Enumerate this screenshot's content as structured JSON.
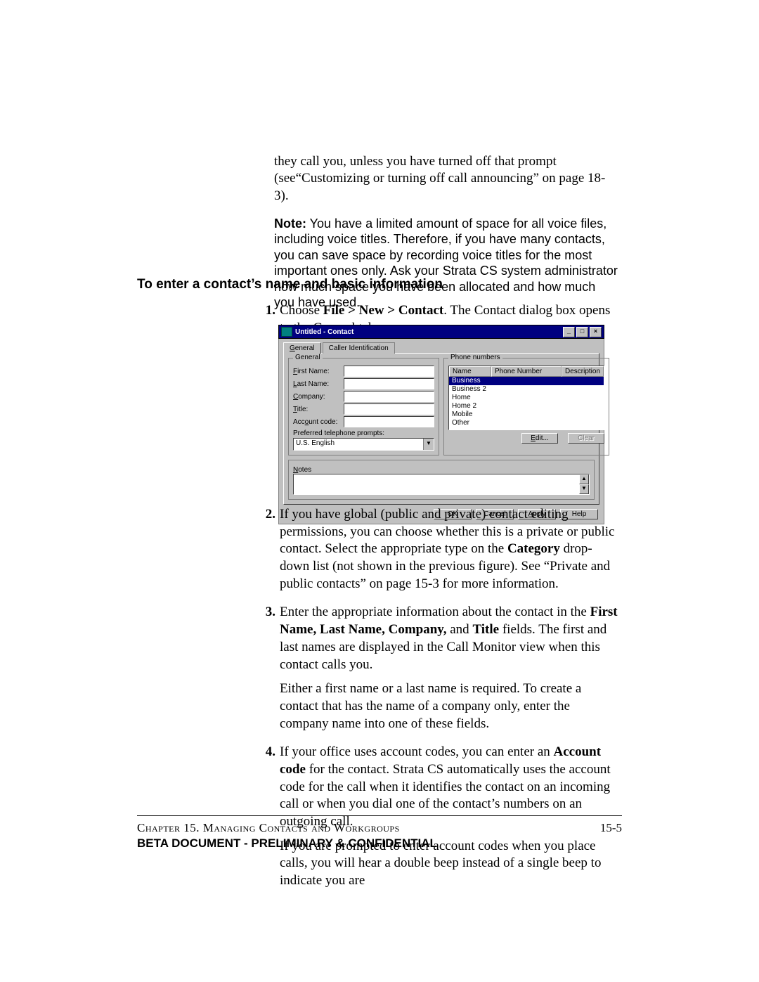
{
  "intro": {
    "p1": "they call you, unless you have turned off that prompt (see“Customizing or turning off call announcing” on page 18-3).",
    "note_label": "Note:",
    "note_body": "  You have a limited amount of space for all voice files, including voice titles. Therefore, if you have many contacts, you can save space by recording voice titles for the most important ones only. Ask your Strata CS system administrator how much space you have been allocated and how much you have used."
  },
  "subhead": "To enter a contact’s name and basic information",
  "steps": {
    "s1": {
      "num": "1.",
      "pre": "Choose ",
      "bold": "File > New > Contact",
      "post": ". The Contact dialog box opens to the General tab."
    },
    "s2": {
      "num": "2.",
      "pre": "If you have global (public and private) contact editing permissions, you can choose whether this is a private or public contact. Select the appropriate type on the ",
      "bold": "Category",
      "post": " drop-down list (not shown in the previous figure). See “Private and public contacts” on page 15-3 for more information."
    },
    "s3": {
      "num": "3.",
      "pre": "Enter the appropriate information about the contact in the ",
      "bold": "First Name, Last Name, Company,",
      "post_mid": " and ",
      "bold2": "Title",
      "post": " fields. The first and last names are displayed in the Call Monitor view when this contact calls you.",
      "p2": "Either a first name or a last name is required. To create a contact that has the name of a company only, enter the company name into one of these fields."
    },
    "s4": {
      "num": "4.",
      "pre": "If your office uses account codes, you can enter an ",
      "bold": "Account code",
      "post": " for the contact. Strata CS automatically uses the account code for the call when it identifies the contact on an incoming call or when you dial one of the contact’s numbers on an outgoing call.",
      "p2": "If you are prompted to enter account codes when you place calls, you will hear a double beep instead of a single beep to indicate you are"
    }
  },
  "dialog": {
    "title": "Untitled - Contact",
    "tabs": {
      "general": "General",
      "caller": "Caller Identification"
    },
    "group_general": "General",
    "labels": {
      "first": "First Name:",
      "last": "Last Name:",
      "company": "Company:",
      "title": "Title:",
      "account": "Account code:",
      "prompt": "Preferred telephone prompts:"
    },
    "combo_value": "U.S. English",
    "group_phone": "Phone numbers",
    "phone_head": {
      "name": "Name",
      "num": "Phone Number",
      "desc": "Description"
    },
    "phone_rows": [
      "Business",
      "Business 2",
      "Home",
      "Home 2",
      "Mobile",
      "Other"
    ],
    "btn_edit": "Edit...",
    "btn_clear": "Clear",
    "group_notes": "Notes",
    "btn_ok": "OK",
    "btn_cancel": "Cancel",
    "btn_apply": "Apply",
    "btn_help": "Help"
  },
  "footer": {
    "chapter": "Chapter 15. Managing Contacts and Workgroups",
    "page": "15-5",
    "confidential": "BETA DOCUMENT - PRELIMINARY & CONFIDENTIAL"
  }
}
